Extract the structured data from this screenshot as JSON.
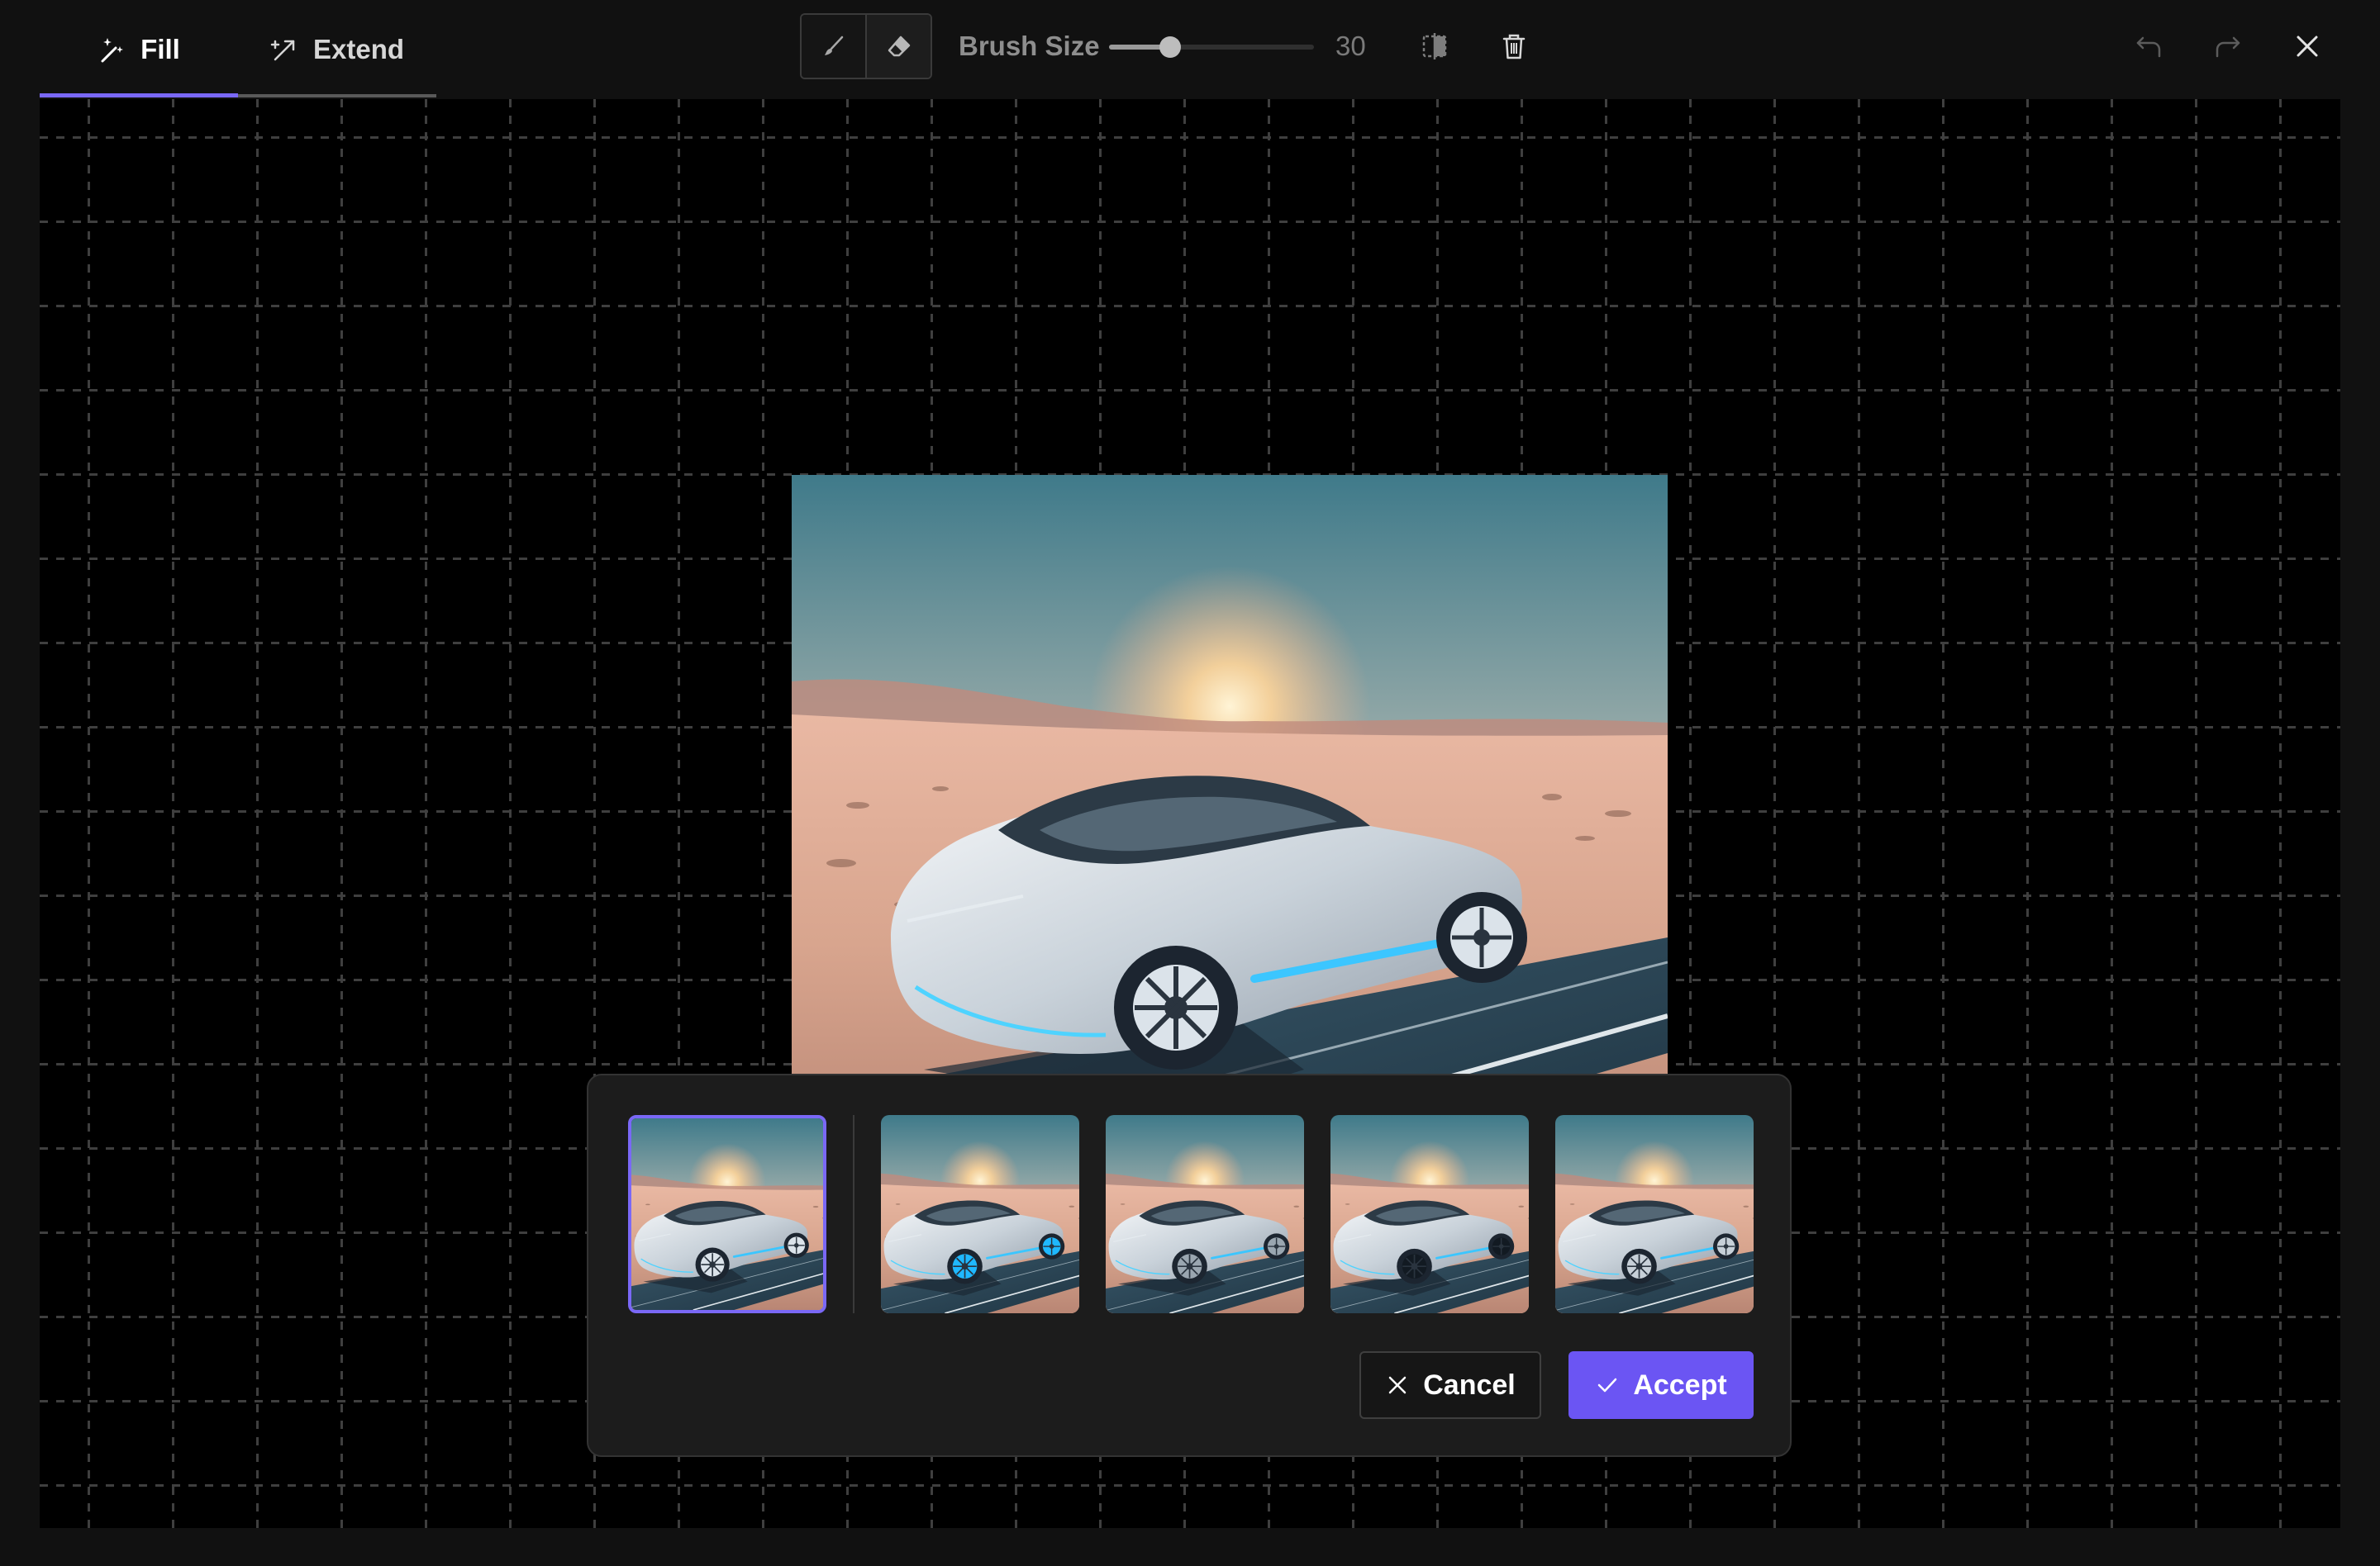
{
  "toolbar": {
    "tabs": [
      {
        "label": "Fill",
        "icon": "sparkle-wand-icon",
        "active": true
      },
      {
        "label": "Extend",
        "icon": "expand-arrow-icon",
        "active": false
      }
    ],
    "tools": [
      {
        "icon": "brush-icon",
        "active": true
      },
      {
        "icon": "eraser-icon",
        "active": false
      }
    ],
    "brush_size_label": "Brush Size",
    "brush_size_value": "30",
    "brush_size_fraction": 0.3,
    "icons": [
      "compare-icon",
      "trash-icon",
      "undo-icon",
      "redo-icon",
      "close-icon"
    ]
  },
  "canvas": {
    "image_subject": "silver electric concept car on desert road at sunset"
  },
  "variations": {
    "count": 5,
    "selected_index": 0
  },
  "actions": {
    "cancel_label": "Cancel",
    "accept_label": "Accept"
  },
  "colors": {
    "accent": "#6b55f3",
    "selected_border": "#7a68f6",
    "background": "#111111",
    "canvas": "#000000",
    "panel": "#1c1c1c"
  }
}
